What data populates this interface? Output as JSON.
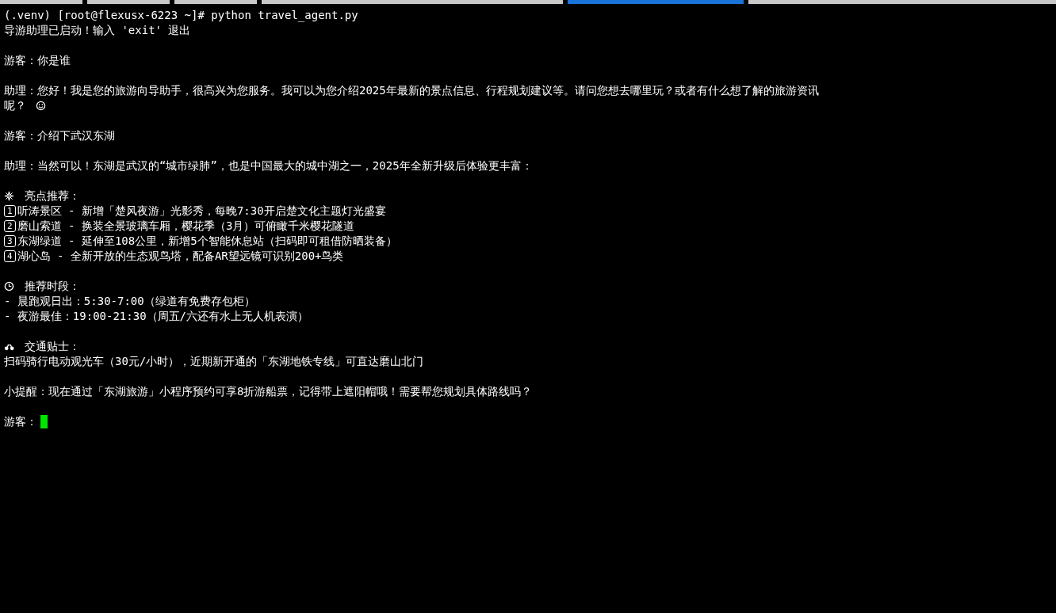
{
  "tabs": [
    {
      "selected": false
    },
    {
      "selected": false
    },
    {
      "selected": false
    },
    {
      "selected": false
    },
    {
      "selected": true
    },
    {
      "selected": false
    }
  ],
  "terminal": {
    "lines": [
      {
        "kind": "text",
        "text": "(.venv) [root@flexusx-6223 ~]# python travel_agent.py"
      },
      {
        "kind": "text",
        "text": "导游助理已启动！输入 'exit' 退出"
      },
      {
        "kind": "blank"
      },
      {
        "kind": "text",
        "text": "游客：你是谁"
      },
      {
        "kind": "blank"
      },
      {
        "kind": "text",
        "text": "助理：您好！我是您的旅游向导助手，很高兴为您服务。我可以为您介绍2025年最新的景点信息、行程规划建议等。请问您想去哪里玩？或者有什么想了解的旅游资讯"
      },
      {
        "kind": "smiley",
        "text": "呢？"
      },
      {
        "kind": "blank"
      },
      {
        "kind": "text",
        "text": "游客：介绍下武汉东湖"
      },
      {
        "kind": "blank"
      },
      {
        "kind": "text",
        "text": "助理：当然可以！东湖是武汉的“城市绿肺”，也是中国最大的城中湖之一，2025年全新升级后体验更丰富："
      },
      {
        "kind": "blank"
      },
      {
        "kind": "sparkle",
        "text": "亮点推荐："
      },
      {
        "kind": "keycap",
        "key": "1",
        "text": "听涛景区 - 新增「楚风夜游」光影秀，每晚7:30开启楚文化主题灯光盛宴"
      },
      {
        "kind": "keycap",
        "key": "2",
        "text": "磨山索道 - 换装全景玻璃车厢，樱花季（3月）可俯瞰千米樱花隧道"
      },
      {
        "kind": "keycap",
        "key": "3",
        "text": "东湖绿道 - 延伸至108公里，新增5个智能休息站（扫码即可租借防晒装备）"
      },
      {
        "kind": "keycap",
        "key": "4",
        "text": "湖心岛 - 全新开放的生态观鸟塔，配备AR望远镜可识别200+鸟类"
      },
      {
        "kind": "blank"
      },
      {
        "kind": "clock",
        "text": "推荐时段："
      },
      {
        "kind": "text",
        "text": "- 晨跑观日出：5:30-7:00（绿道有免费存包柜）"
      },
      {
        "kind": "text",
        "text": "- 夜游最佳：19:00-21:30（周五/六还有水上无人机表演）"
      },
      {
        "kind": "blank"
      },
      {
        "kind": "bike",
        "text": "交通贴士："
      },
      {
        "kind": "text",
        "text": "扫码骑行电动观光车（30元/小时），近期新开通的「东湖地铁专线」可直达磨山北门"
      },
      {
        "kind": "blank"
      },
      {
        "kind": "text",
        "text": "小提醒：现在通过「东湖旅游」小程序预约可享8折游船票，记得带上遮阳帽哦！需要帮您规划具体路线吗？"
      },
      {
        "kind": "blank"
      },
      {
        "kind": "prompt",
        "text": "游客："
      }
    ]
  }
}
